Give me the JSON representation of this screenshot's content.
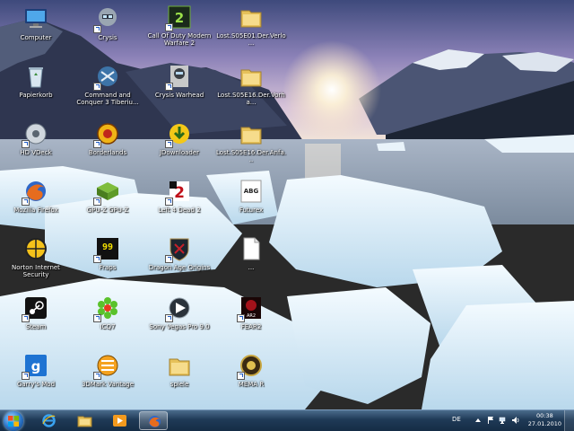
{
  "desktop": {
    "icons": [
      {
        "label": "Computer",
        "icon": "computer-icon"
      },
      {
        "label": "Crysis",
        "icon": "crysis-icon"
      },
      {
        "label": "Call Of Duty Modern Warfare 2",
        "icon": "cod-mw2-icon"
      },
      {
        "label": "Lost.S05E01.Der.Verlo...",
        "icon": "folder-icon"
      },
      {
        "label": "Papierkorb",
        "icon": "recycle-bin-icon"
      },
      {
        "label": "Command and Conquer 3 Tiberiu...",
        "icon": "cnc3-icon"
      },
      {
        "label": "Crysis Warhead",
        "icon": "crysis-warhead-icon"
      },
      {
        "label": "Lost.S05E16.Der.Vorha...",
        "icon": "folder-icon"
      },
      {
        "label": "HD VDeck",
        "icon": "hd-vdeck-icon"
      },
      {
        "label": "Borderlands",
        "icon": "borderlands-icon"
      },
      {
        "label": "JDownloader",
        "icon": "jdownloader-icon"
      },
      {
        "label": "Lost.S05E16.Der.Anfa...",
        "icon": "folder-icon"
      },
      {
        "label": "Mozilla Firefox",
        "icon": "firefox-icon"
      },
      {
        "label": "GPU-Z GPU-Z",
        "icon": "gpu-z-icon"
      },
      {
        "label": "Left 4 Dead 2",
        "icon": "left4dead2-icon"
      },
      {
        "label": "Futurex",
        "icon": "text-document-icon"
      },
      {
        "label": "Norton Internet Security",
        "icon": "norton-icon"
      },
      {
        "label": "Fraps",
        "icon": "fraps-icon"
      },
      {
        "label": "Dragon Age Origins",
        "icon": "dragon-age-icon"
      },
      {
        "label": "...",
        "icon": "blank-file-icon"
      },
      {
        "label": "Steam",
        "icon": "steam-icon"
      },
      {
        "label": "ICQ7",
        "icon": "icq-icon"
      },
      {
        "label": "Sony Vegas Pro 9.0",
        "icon": "sony-vegas-icon"
      },
      {
        "label": "FEAR2",
        "icon": "fear2-icon"
      },
      {
        "label": "Garry's Mod",
        "icon": "garrys-mod-icon"
      },
      {
        "label": "3DMark Vantage",
        "icon": "3dmark-icon"
      },
      {
        "label": "spiele",
        "icon": "folder-icon"
      },
      {
        "label": "MEMA R",
        "icon": "game-icon"
      }
    ]
  },
  "taskbar": {
    "buttons": [
      {
        "name": "internet-explorer",
        "icon": "internet-explorer-icon"
      },
      {
        "name": "windows-explorer",
        "icon": "explorer-folder-icon"
      },
      {
        "name": "media-player",
        "icon": "media-player-icon"
      },
      {
        "name": "firefox",
        "icon": "firefox-icon",
        "active": true
      }
    ],
    "tray": {
      "language": "DE",
      "time": "00:38",
      "date": "27.01.2010"
    }
  },
  "colors": {
    "taskbar": "#1f3a57",
    "sky": "#9b8fc4",
    "water": "#7d8ea0",
    "ice": "#d9ecf7"
  }
}
